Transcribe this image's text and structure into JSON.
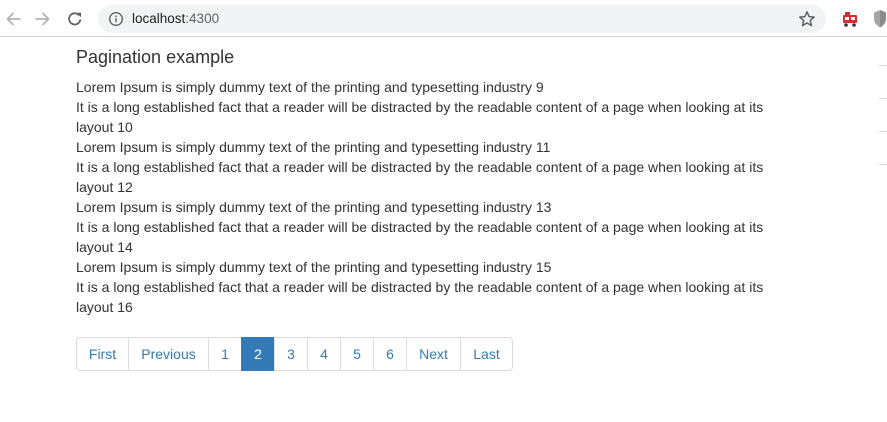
{
  "browser": {
    "url_host": "localhost",
    "url_port": ":4300"
  },
  "page": {
    "title": "Pagination example",
    "paragraphs": [
      "Lorem Ipsum is simply dummy text of the printing and typesetting industry 9",
      "It is a long established fact that a reader will be distracted by the readable content of a page when looking at its layout 10",
      "Lorem Ipsum is simply dummy text of the printing and typesetting industry 11",
      "It is a long established fact that a reader will be distracted by the readable content of a page when looking at its layout 12",
      "Lorem Ipsum is simply dummy text of the printing and typesetting industry 13",
      "It is a long established fact that a reader will be distracted by the readable content of a page when looking at its layout 14",
      "Lorem Ipsum is simply dummy text of the printing and typesetting industry 15",
      "It is a long established fact that a reader will be distracted by the readable content of a page when looking at its layout 16"
    ]
  },
  "pagination": {
    "first": "First",
    "previous": "Previous",
    "pages": [
      "1",
      "2",
      "3",
      "4",
      "5",
      "6"
    ],
    "current_page": "2",
    "next": "Next",
    "last": "Last"
  },
  "colors": {
    "link": "#337ab7",
    "active_bg": "#337ab7",
    "text": "#333333",
    "border": "#dddddd"
  },
  "icons": [
    "back-arrow-icon",
    "forward-arrow-icon",
    "reload-icon",
    "info-icon",
    "star-icon",
    "extension-icon",
    "shield-extension-icon"
  ]
}
